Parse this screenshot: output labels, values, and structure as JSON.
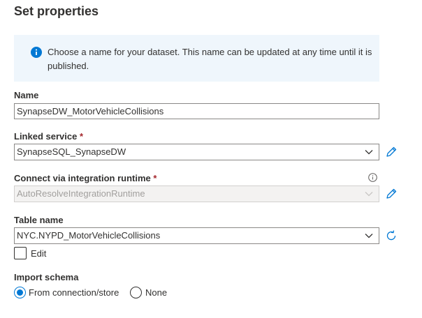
{
  "title": "Set properties",
  "info_banner": {
    "icon": "info-icon",
    "text": "Choose a name for your dataset. This name can be updated at any time until it is published."
  },
  "name_field": {
    "label": "Name",
    "value": "SynapseDW_MotorVehicleCollisions"
  },
  "linked_service": {
    "label": "Linked service",
    "required_marker": "*",
    "value": "SynapseSQL_SynapseDW"
  },
  "integration_runtime": {
    "label": "Connect via integration runtime",
    "required_marker": "*",
    "value": "AutoResolveIntegrationRuntime"
  },
  "table_name": {
    "label": "Table name",
    "value": "NYC.NYPD_MotorVehicleCollisions",
    "edit_label": "Edit"
  },
  "import_schema": {
    "label": "Import schema",
    "options": [
      "From connection/store",
      "None"
    ],
    "selected": "From connection/store"
  },
  "colors": {
    "accent": "#0078d4",
    "required": "#a4262c",
    "info_background": "#eff6fc"
  }
}
